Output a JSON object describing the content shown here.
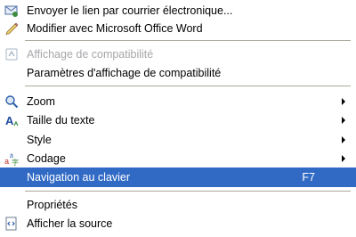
{
  "menu": {
    "items": [
      {
        "label": "Envoyer le lien par courrier électronique...",
        "icon": "email-link-icon"
      },
      {
        "label": "Modifier avec Microsoft Office Word",
        "icon": "pencil-icon"
      },
      {
        "label": "Affichage de compatibilité",
        "icon": "compatibility-view-icon",
        "disabled": true
      },
      {
        "label": "Paramètres d'affichage de compatibilité"
      },
      {
        "label": "Zoom",
        "icon": "zoom-icon",
        "submenu": true
      },
      {
        "label": "Taille du texte",
        "icon": "text-size-icon",
        "submenu": true
      },
      {
        "label": "Style",
        "submenu": true
      },
      {
        "label": "Codage",
        "icon": "encoding-icon",
        "submenu": true
      },
      {
        "label": "Navigation au clavier",
        "shortcut": "F7",
        "selected": true
      },
      {
        "label": "Propriétés"
      },
      {
        "label": "Afficher la source",
        "icon": "view-source-icon"
      }
    ]
  },
  "colors": {
    "selection": "#316ac5",
    "disabled_text": "#a7a6aa",
    "separator": "#aca899"
  }
}
